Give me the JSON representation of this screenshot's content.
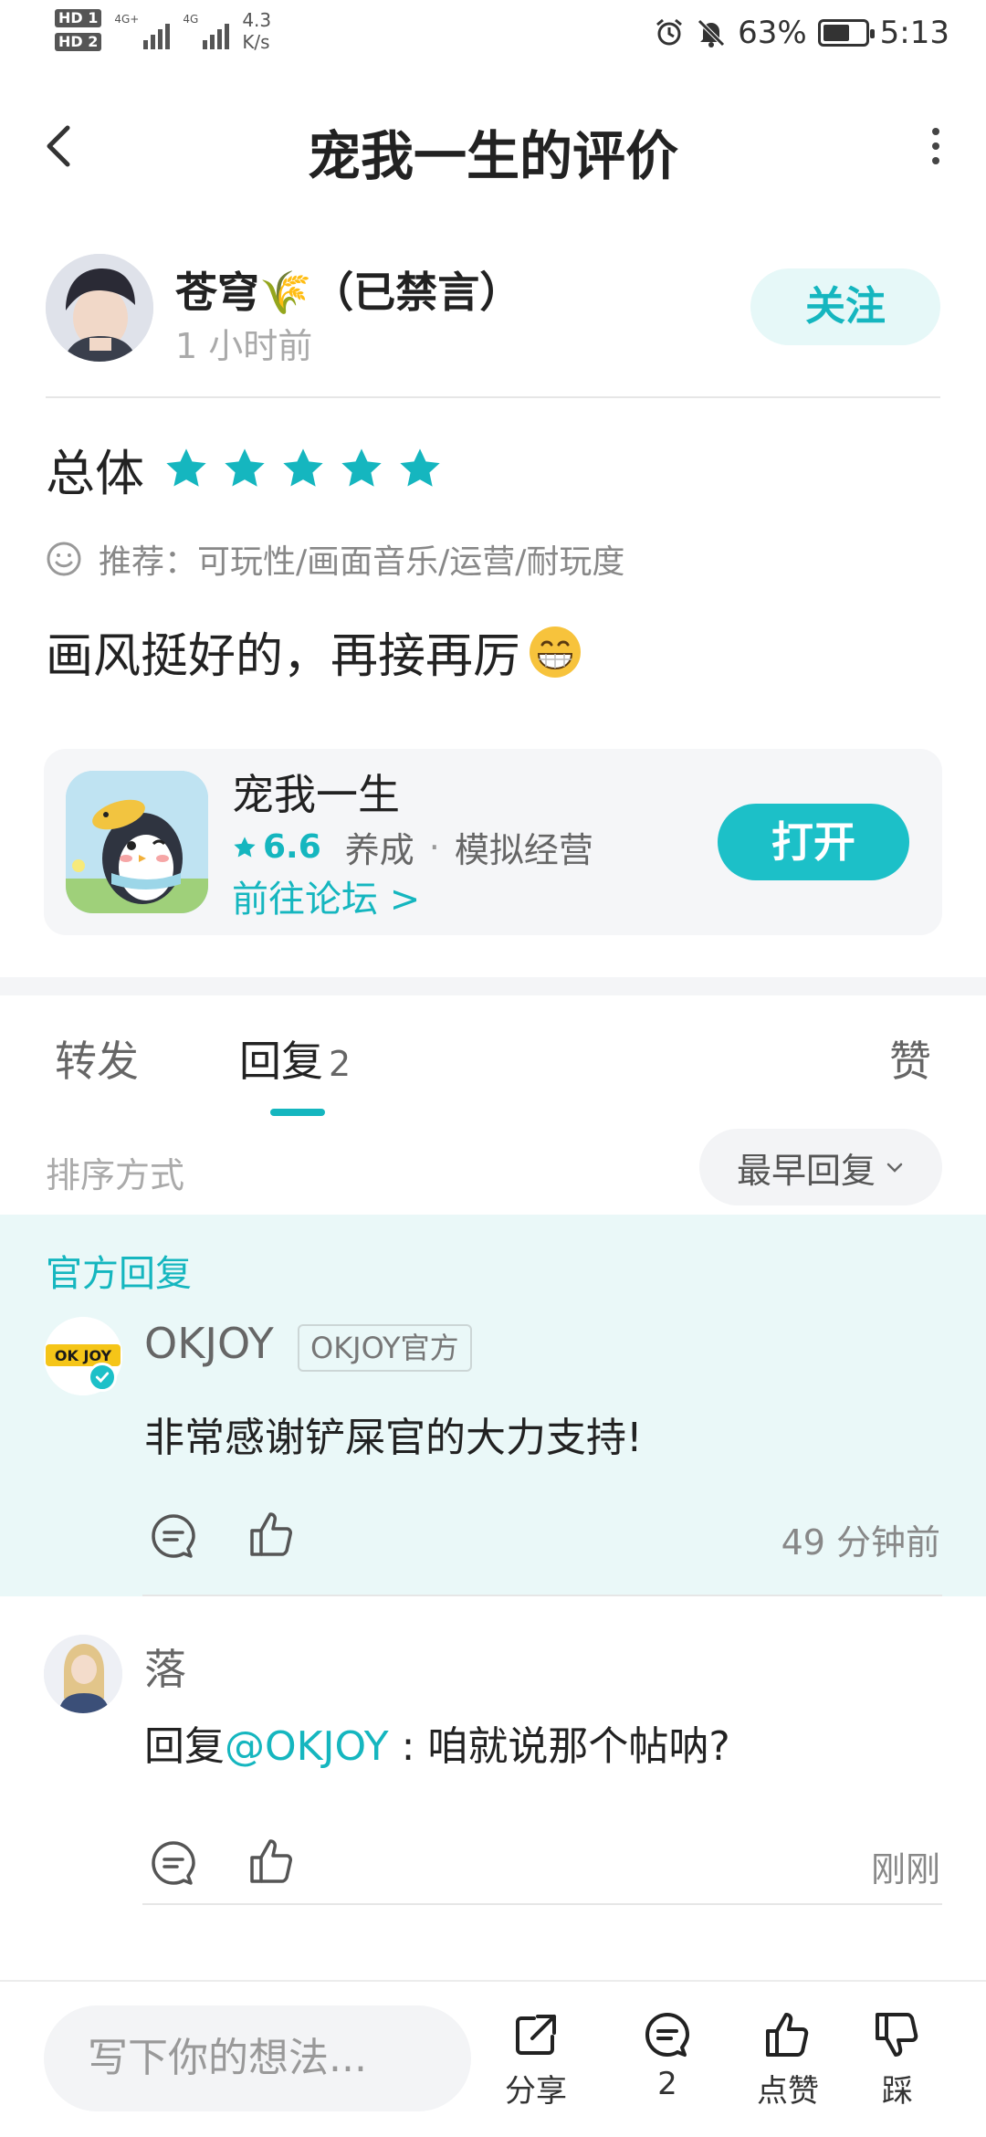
{
  "status_bar": {
    "hd1": "HD 1",
    "hd2": "HD 2",
    "signal1": "4G+",
    "signal2": "4G",
    "net_speed": "4.3",
    "net_unit": "K/s",
    "battery_percent": "63%",
    "battery_level": 0.63,
    "time": "5:13"
  },
  "header": {
    "title": "宠我一生的评价"
  },
  "review": {
    "user_name": "苍穹🌾（已禁言）",
    "time": "1 小时前",
    "follow_label": "关注",
    "overall_label": "总体",
    "stars": 5,
    "recommend_text": "推荐：可玩性/画面音乐/运营/耐玩度",
    "content": "画风挺好的，再接再厉",
    "accent_color": "#15b6bf"
  },
  "app_card": {
    "name": "宠我一生",
    "rating": "6.6",
    "tag1": "养成",
    "tag2": "模拟经营",
    "forum_link": "前往论坛 >",
    "open_label": "打开"
  },
  "tabs": {
    "forward": "转发",
    "replies": "回复",
    "replies_count": "2",
    "like": "赞"
  },
  "sort": {
    "label": "排序方式",
    "selected": "最早回复"
  },
  "official": {
    "section_title": "官方回复"
  },
  "replies": [
    {
      "name": "OKJOY",
      "tag": "OKJOY官方",
      "avatar_text": "OK JOY",
      "text": "非常感谢铲屎官的大力支持!",
      "time": "49 分钟前"
    },
    {
      "name": "落",
      "text_prefix": "回复",
      "mention": "@OKJOY",
      "text": " : 咱就说那个帖呐?",
      "time": "刚刚"
    }
  ],
  "bottom_bar": {
    "input_placeholder": "写下你的想法...",
    "share_label": "分享",
    "comment_count": "2",
    "like_label": "点赞",
    "dislike_label": "踩"
  }
}
